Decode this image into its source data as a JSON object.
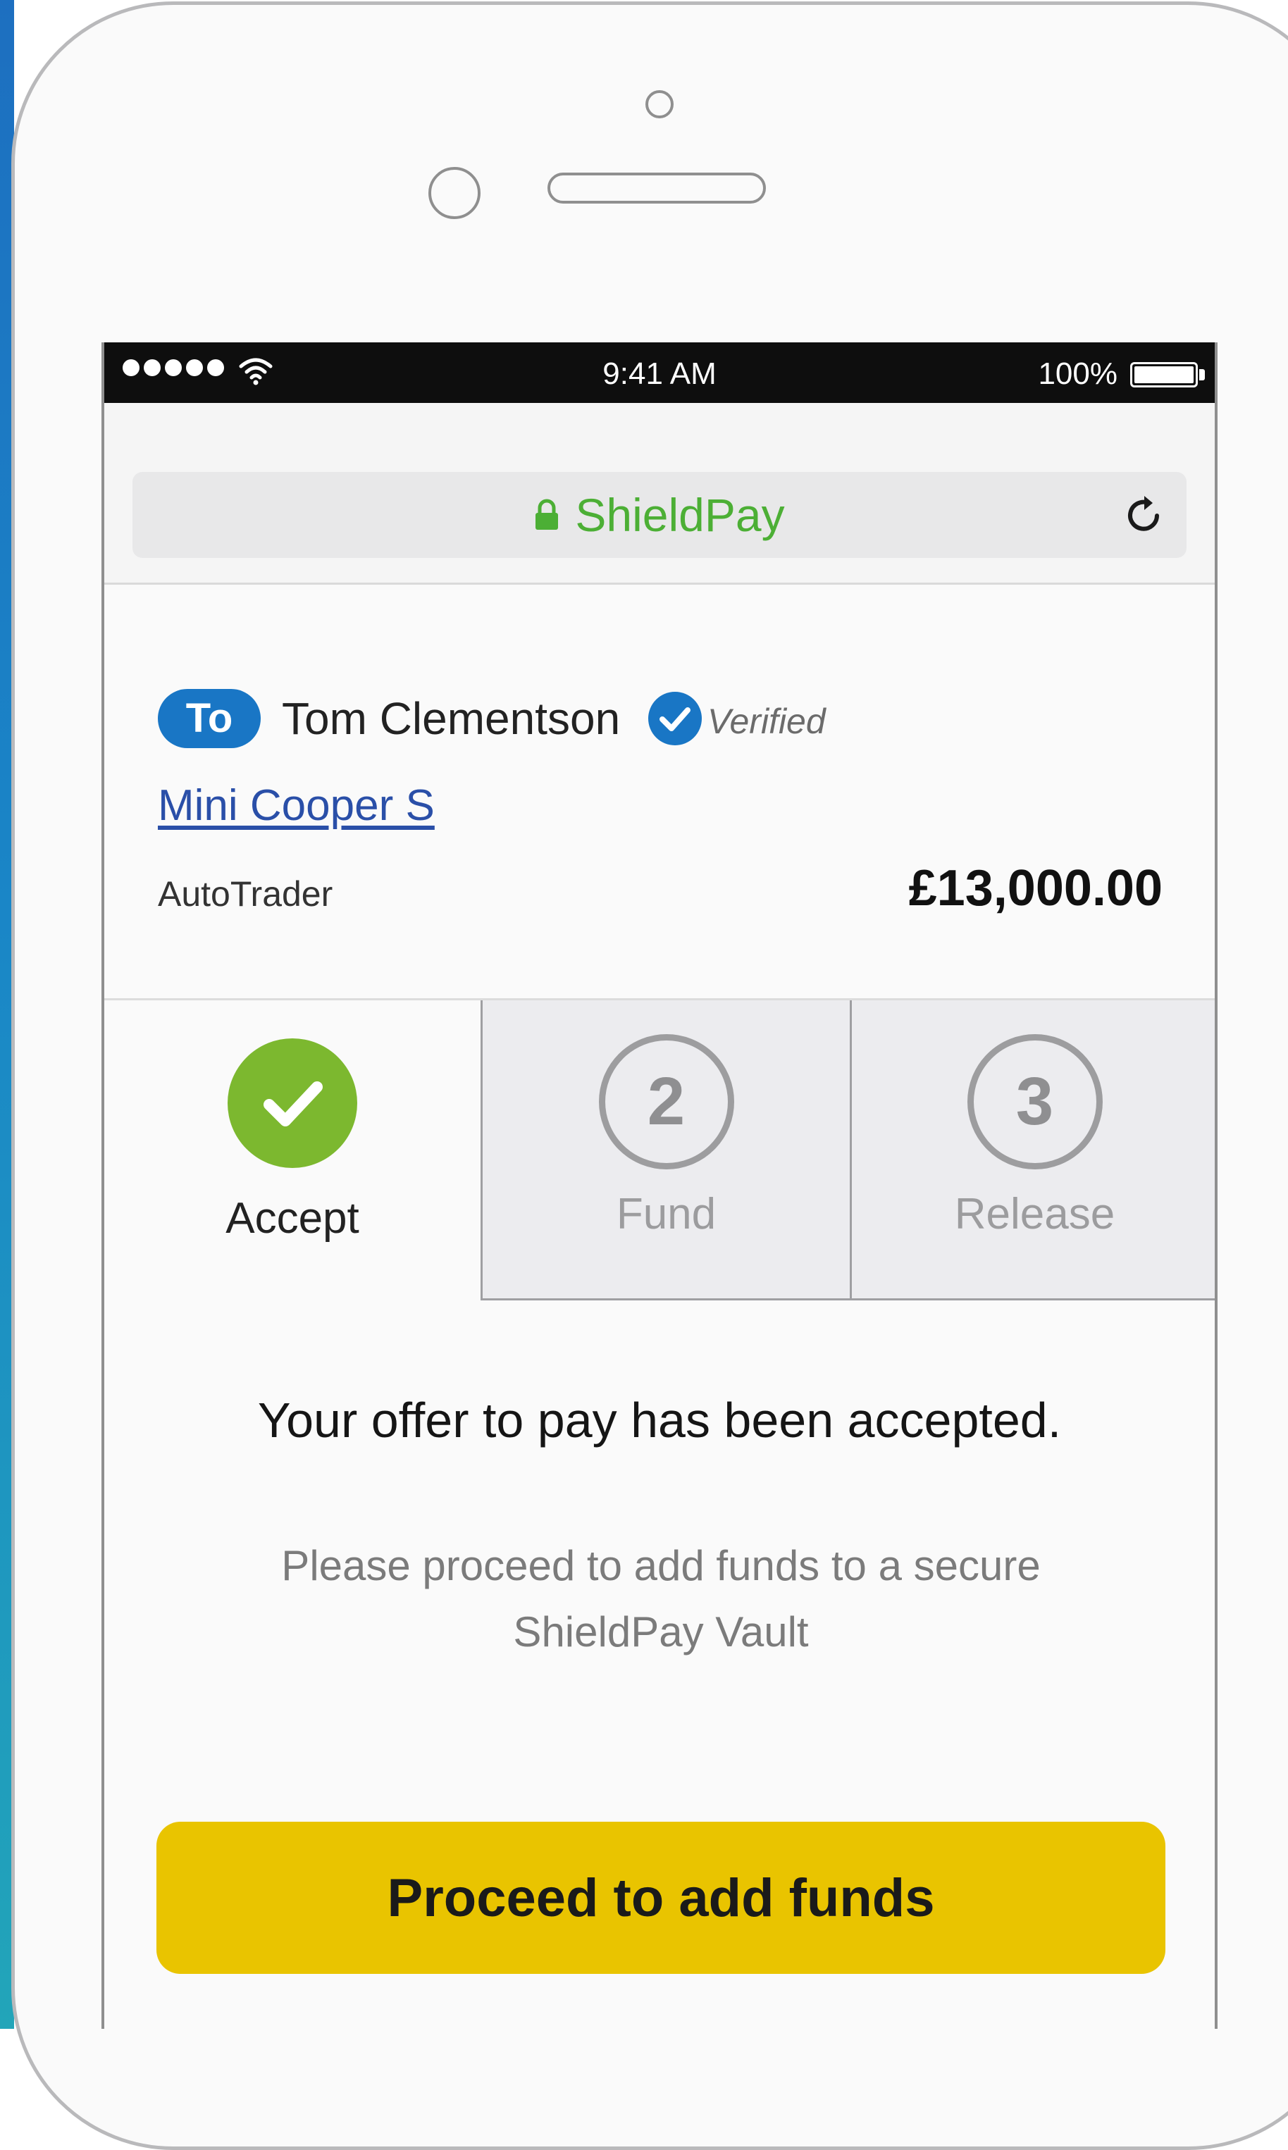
{
  "status_bar": {
    "time": "9:41 AM",
    "battery": "100%",
    "battery_level_fraction": 1.0,
    "signal_bars": 5
  },
  "browser": {
    "site_name": "ShieldPay",
    "secure_icon": "lock-icon",
    "reload_icon": "reload-icon",
    "accent": "#4caf35"
  },
  "recipient": {
    "to_label": "To",
    "name": "Tom Clementson",
    "verified_label": "Verified",
    "item_title": "Mini Cooper S",
    "source": "AutoTrader",
    "amount": "£13,000.00",
    "badge_color": "#1976c5"
  },
  "steps": [
    {
      "number": "",
      "label": "Accept",
      "state": "complete",
      "icon": "checkmark-icon",
      "color": "#7cb82f"
    },
    {
      "number": "2",
      "label": "Fund",
      "state": "pending"
    },
    {
      "number": "3",
      "label": "Release",
      "state": "pending"
    }
  ],
  "message": {
    "headline": "Your offer to pay has been accepted.",
    "detail": "Please proceed to add funds to a secure ShieldPay Vault"
  },
  "cta": {
    "label": "Proceed to add funds",
    "color": "#e9c400"
  }
}
